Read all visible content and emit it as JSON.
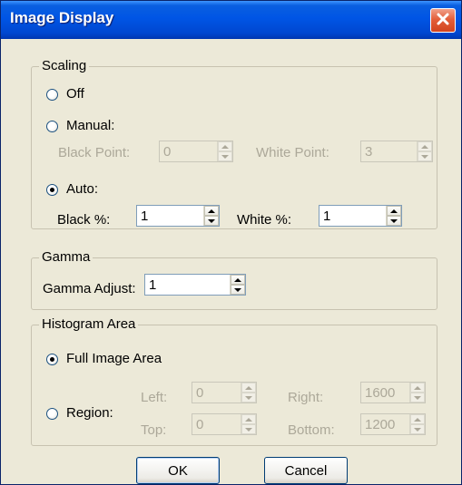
{
  "window": {
    "title": "Image Display"
  },
  "scaling": {
    "legend": "Scaling",
    "off_label": "Off",
    "manual_label": "Manual:",
    "black_point_label": "Black Point:",
    "black_point_value": "0",
    "white_point_label": "White Point:",
    "white_point_value": "3",
    "auto_label": "Auto:",
    "black_pct_label": "Black %:",
    "black_pct_value": "1",
    "white_pct_label": "White %:",
    "white_pct_value": "1",
    "selected": "auto"
  },
  "gamma": {
    "legend": "Gamma",
    "adjust_label": "Gamma Adjust:",
    "adjust_value": "1"
  },
  "histogram": {
    "legend": "Histogram Area",
    "full_label": "Full Image Area",
    "region_label": "Region:",
    "left_label": "Left:",
    "left_value": "0",
    "top_label": "Top:",
    "top_value": "0",
    "right_label": "Right:",
    "right_value": "1600",
    "bottom_label": "Bottom:",
    "bottom_value": "1200",
    "selected": "full"
  },
  "buttons": {
    "ok_label": "OK",
    "cancel_label": "Cancel"
  },
  "colors": {
    "titlebar": "#0055e5",
    "dialog_bg": "#ece9d8",
    "close_button": "#e35f3a",
    "disabled_text": "#aca899"
  },
  "icons": {
    "close": "close-icon",
    "spin_up": "up-arrow-icon",
    "spin_down": "down-arrow-icon"
  }
}
